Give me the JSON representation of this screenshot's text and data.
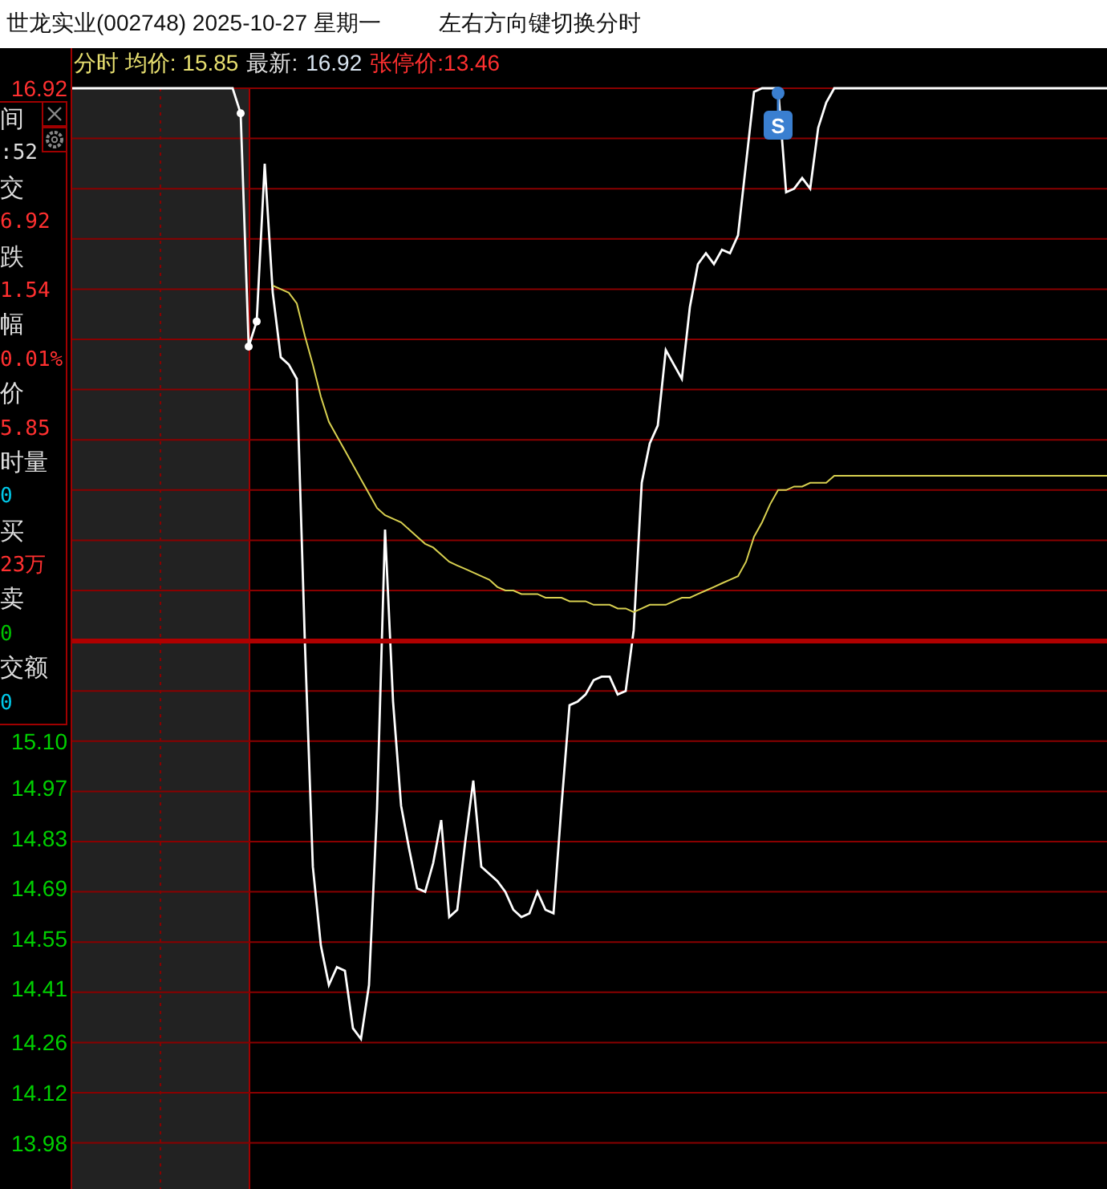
{
  "window": {
    "title": "世龙实业(002748) 2025-10-27 星期一",
    "hint": "左右方向键切换分时"
  },
  "legend": [
    {
      "text": "分时 均价: 15.85",
      "color": "#e8e070"
    },
    {
      "text": "最新:",
      "color": "#e0e0e0"
    },
    {
      "text": "16.92",
      "color": "#d8e4f0"
    },
    {
      "text": "张停价:13.46",
      "color": "#ff3030"
    }
  ],
  "info_panel": [
    {
      "label": "间",
      "value": ":52",
      "color": "#dddddd"
    },
    {
      "label": "交",
      "value": "6.92",
      "color": "#ff3030"
    },
    {
      "label": "跌",
      "value": "1.54",
      "color": "#ff3030"
    },
    {
      "label": "幅",
      "value": "0.01%",
      "color": "#ff3030"
    },
    {
      "label": "价",
      "value": "5.85",
      "color": "#ff3030"
    },
    {
      "label": "时量",
      "value": "0",
      "color": "#00c8e8"
    },
    {
      "label": "买",
      "value": "23万",
      "color": "#ff3030"
    },
    {
      "label": "卖",
      "value": "0",
      "color": "#00c000"
    },
    {
      "label": "交额",
      "value": "0",
      "color": "#00c8e8"
    }
  ],
  "signal": {
    "label": "S"
  },
  "chart_data": {
    "type": "line",
    "grid": true,
    "ylim": [
      13.84,
      16.92
    ],
    "yticks": [
      {
        "value": 16.92,
        "label": "16.92"
      },
      {
        "value": 15.1,
        "label": "15.10"
      },
      {
        "value": 14.97,
        "label": "14.97"
      },
      {
        "value": 14.83,
        "label": "14.83"
      },
      {
        "value": 14.69,
        "label": "14.69"
      },
      {
        "value": 14.55,
        "label": "14.55"
      },
      {
        "value": 14.41,
        "label": "14.41"
      },
      {
        "value": 14.26,
        "label": "14.26"
      },
      {
        "value": 14.12,
        "label": "14.12"
      },
      {
        "value": 13.98,
        "label": "13.98"
      }
    ],
    "series": [
      {
        "color": "#ffffff",
        "values": [
          16.92,
          16.92,
          16.92,
          16.92,
          16.92,
          16.92,
          16.92,
          16.92,
          16.92,
          16.92,
          16.92,
          16.92,
          16.92,
          16.92,
          16.92,
          16.92,
          16.92,
          16.92,
          16.92,
          16.92,
          16.92,
          16.85,
          16.2,
          16.27,
          16.71,
          16.35,
          16.17,
          16.15,
          16.11,
          15.38,
          14.75,
          14.53,
          14.42,
          14.47,
          14.46,
          14.3,
          14.27,
          14.42,
          14.91,
          15.69,
          15.21,
          14.92,
          14.8,
          14.69,
          14.68,
          14.76,
          14.88,
          14.61,
          14.63,
          14.82,
          14.99,
          14.75,
          14.73,
          14.71,
          14.68,
          14.63,
          14.61,
          14.62,
          14.68,
          14.63,
          14.62,
          14.92,
          15.2,
          15.21,
          15.23,
          15.27,
          15.28,
          15.28,
          15.23,
          15.24,
          15.41,
          15.82,
          15.93,
          15.98,
          16.19,
          16.15,
          16.11,
          16.31,
          16.43,
          16.46,
          16.43,
          16.47,
          16.46,
          16.51,
          16.71,
          16.91,
          16.92,
          16.92,
          16.92,
          16.63,
          16.64,
          16.67,
          16.64,
          16.81,
          16.88,
          16.92,
          16.92,
          16.92,
          16.92,
          16.92,
          16.92,
          16.92,
          16.92,
          16.92,
          16.92,
          16.92,
          16.92,
          16.92,
          16.92,
          16.92,
          16.92,
          16.92,
          16.92,
          16.92,
          16.92,
          16.92,
          16.92,
          16.92,
          16.92,
          16.92,
          16.92,
          16.92,
          16.92,
          16.92,
          16.92,
          16.92,
          16.92,
          16.92,
          16.92,
          16.92
        ]
      },
      {
        "color": "#d8d050",
        "values": [
          null,
          null,
          null,
          null,
          null,
          null,
          null,
          null,
          null,
          null,
          null,
          null,
          null,
          null,
          null,
          null,
          null,
          null,
          null,
          null,
          null,
          null,
          null,
          null,
          null,
          16.37,
          16.36,
          16.35,
          16.32,
          16.23,
          16.15,
          16.06,
          15.99,
          15.95,
          15.91,
          15.87,
          15.83,
          15.79,
          15.75,
          15.73,
          15.72,
          15.71,
          15.69,
          15.67,
          15.65,
          15.64,
          15.62,
          15.6,
          15.59,
          15.58,
          15.57,
          15.56,
          15.55,
          15.53,
          15.52,
          15.52,
          15.51,
          15.51,
          15.51,
          15.5,
          15.5,
          15.5,
          15.49,
          15.49,
          15.49,
          15.48,
          15.48,
          15.48,
          15.47,
          15.47,
          15.46,
          15.47,
          15.48,
          15.48,
          15.48,
          15.49,
          15.5,
          15.5,
          15.51,
          15.52,
          15.53,
          15.54,
          15.55,
          15.56,
          15.6,
          15.67,
          15.71,
          15.76,
          15.8,
          15.8,
          15.81,
          15.81,
          15.82,
          15.82,
          15.82,
          15.84,
          15.84,
          15.84,
          15.84,
          15.84,
          15.84,
          15.84,
          15.84,
          15.84,
          15.84,
          15.84,
          15.84,
          15.84,
          15.84,
          15.84,
          15.84,
          15.84,
          15.84,
          15.84,
          15.84,
          15.84,
          15.84,
          15.84,
          15.84,
          15.84,
          15.84,
          15.84,
          15.84,
          15.84,
          15.84,
          15.84,
          15.84,
          15.84,
          15.84,
          15.84
        ]
      }
    ]
  }
}
